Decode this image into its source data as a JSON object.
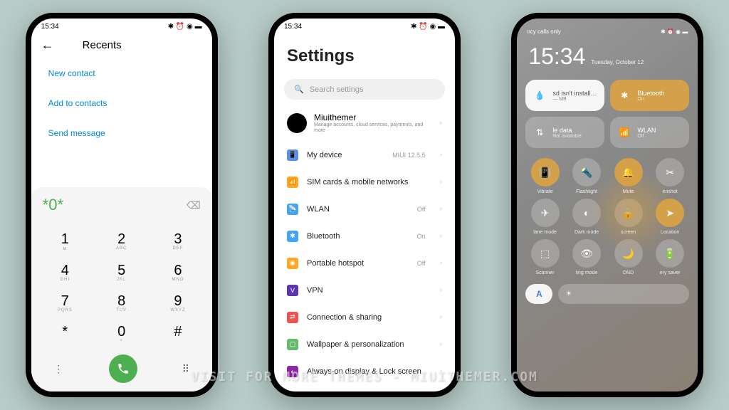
{
  "statusbar": {
    "time": "15:34",
    "icons": "✱ ⏰ ◉ ▬"
  },
  "phone1": {
    "title": "Recents",
    "actions": [
      "New contact",
      "Add to contacts",
      "Send message"
    ],
    "dial": "*0*",
    "keys": [
      {
        "n": "1",
        "l": "ຜ"
      },
      {
        "n": "2",
        "l": "ABC"
      },
      {
        "n": "3",
        "l": "DEF"
      },
      {
        "n": "4",
        "l": "GHI"
      },
      {
        "n": "5",
        "l": "JKL"
      },
      {
        "n": "6",
        "l": "MNO"
      },
      {
        "n": "7",
        "l": "PQRS"
      },
      {
        "n": "8",
        "l": "TUV"
      },
      {
        "n": "9",
        "l": "WXYZ"
      },
      {
        "n": "*",
        "l": ""
      },
      {
        "n": "0",
        "l": "+"
      },
      {
        "n": "#",
        "l": ""
      }
    ]
  },
  "phone2": {
    "title": "Settings",
    "search_placeholder": "Search settings",
    "account": {
      "name": "Miuithemer",
      "sub": "Manage accounts, cloud services, payments, and more"
    },
    "items": [
      {
        "icon": "📱",
        "bg": "#5b8def",
        "label": "My device",
        "value": "MIUI 12.5.5"
      },
      {
        "icon": "📶",
        "bg": "#ffa726",
        "label": "SIM cards & mobile networks",
        "value": ""
      },
      {
        "icon": "📡",
        "bg": "#42a5f5",
        "label": "WLAN",
        "value": "Off"
      },
      {
        "icon": "✱",
        "bg": "#42a5f5",
        "label": "Bluetooth",
        "value": "On"
      },
      {
        "icon": "◉",
        "bg": "#ffa726",
        "label": "Portable hotspot",
        "value": "Off"
      },
      {
        "icon": "V",
        "bg": "#5e35b1",
        "label": "VPN",
        "value": ""
      },
      {
        "icon": "⇄",
        "bg": "#ef5350",
        "label": "Connection & sharing",
        "value": ""
      },
      {
        "icon": "▢",
        "bg": "#66bb6a",
        "label": "Wallpaper & personalization",
        "value": ""
      },
      {
        "icon": "◐",
        "bg": "#8e24aa",
        "label": "Always-on display & Lock screen",
        "value": ""
      }
    ]
  },
  "phone3": {
    "status_left": "ncy calls only",
    "clock": "15:34",
    "date": "Tuesday, October 12",
    "tiles": [
      {
        "style": "white",
        "icon": "💧",
        "title": "sd isn't install…",
        "sub": "— MB"
      },
      {
        "style": "orange",
        "icon": "✱",
        "title": "Bluetooth",
        "sub": "On"
      },
      {
        "style": "grey",
        "icon": "⇅",
        "title": "le data",
        "sub": "Not available"
      },
      {
        "style": "grey",
        "icon": "📶",
        "title": "WLAN",
        "sub": "Off"
      }
    ],
    "toggles": [
      {
        "icon": "📳",
        "label": "Vibrate",
        "active": true
      },
      {
        "icon": "🔦",
        "label": "Flashlight",
        "active": false
      },
      {
        "icon": "🔔",
        "label": "Mute",
        "active": true
      },
      {
        "icon": "✂",
        "label": "enshot",
        "active": false
      },
      {
        "icon": "✈",
        "label": "lane mode",
        "active": false
      },
      {
        "icon": "◐",
        "label": "Dark mode",
        "active": false
      },
      {
        "icon": "🔒",
        "label": "screen",
        "active": false
      },
      {
        "icon": "➤",
        "label": "Location",
        "active": true
      },
      {
        "icon": "⬚",
        "label": "Scanner",
        "active": false
      },
      {
        "icon": "👁",
        "label": "ling mode",
        "active": false
      },
      {
        "icon": "🌙",
        "label": "DND",
        "active": false
      },
      {
        "icon": "🔋",
        "label": "ery saver",
        "active": false
      }
    ],
    "auto": "A"
  },
  "watermark": "VISIT FOR MORE THEMES - MIUITHEMER.COM"
}
